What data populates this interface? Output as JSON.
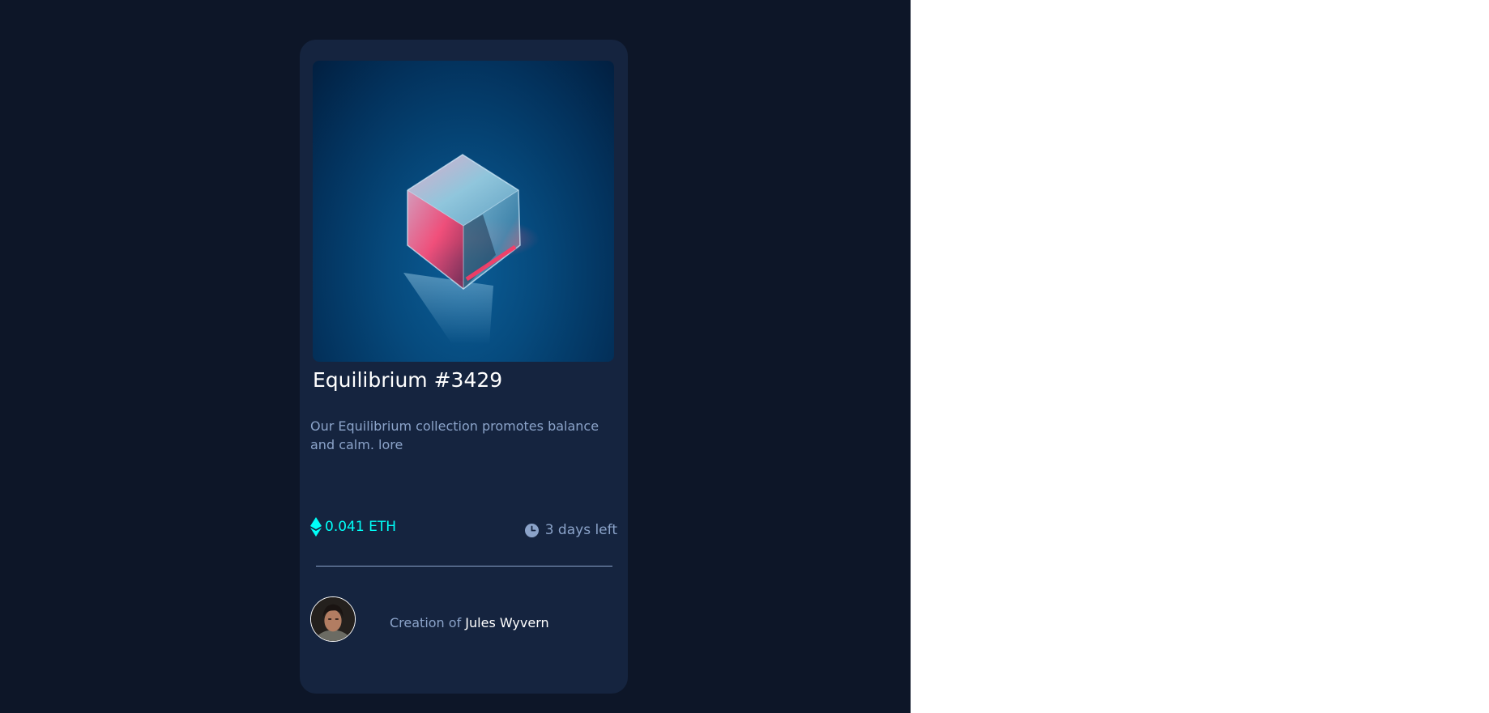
{
  "card": {
    "title": "Equilibrium #3429",
    "description": "Our Equilibrium collection promotes balance and calm. lore",
    "price": "0.041 ETH",
    "time_left": "3 days left",
    "creator_prefix": "Creation of ",
    "creator_name": "Jules Wyvern"
  },
  "icons": {
    "price": "ethereum-icon",
    "time": "clock-icon"
  },
  "colors": {
    "page_background": "#0d1628",
    "card_background": "#15243f",
    "accent_cyan": "#00fff8",
    "muted_text": "#8ba3c9",
    "white": "#ffffff"
  }
}
